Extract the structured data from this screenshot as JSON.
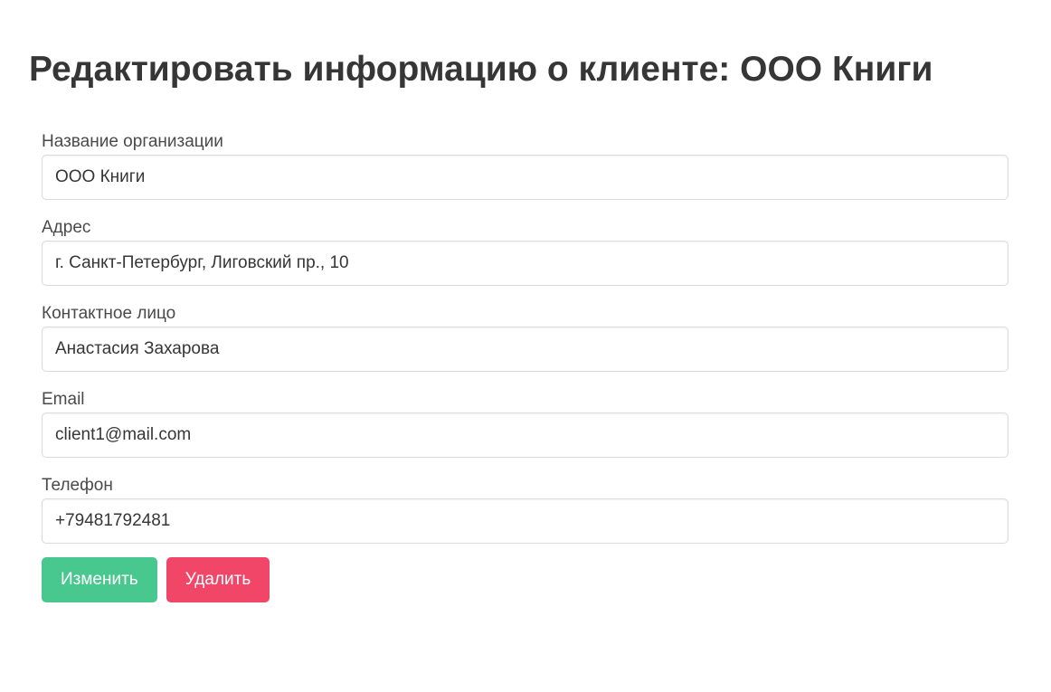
{
  "page": {
    "title": "Редактировать информацию о клиенте: ООО Книги"
  },
  "form": {
    "fields": [
      {
        "label": "Название организации",
        "value": "ООО Книги"
      },
      {
        "label": "Адрес",
        "value": "г. Санкт-Петербург, Лиговский пр., 10"
      },
      {
        "label": "Контактное лицо",
        "value": "Анастасия Захарова"
      },
      {
        "label": "Email",
        "value": "client1@mail.com"
      },
      {
        "label": "Телефон",
        "value": "+79481792481"
      }
    ],
    "buttons": {
      "update_label": "Изменить",
      "delete_label": "Удалить"
    }
  },
  "colors": {
    "update_button": "#48c78e",
    "delete_button": "#f14668",
    "text": "#363636"
  }
}
